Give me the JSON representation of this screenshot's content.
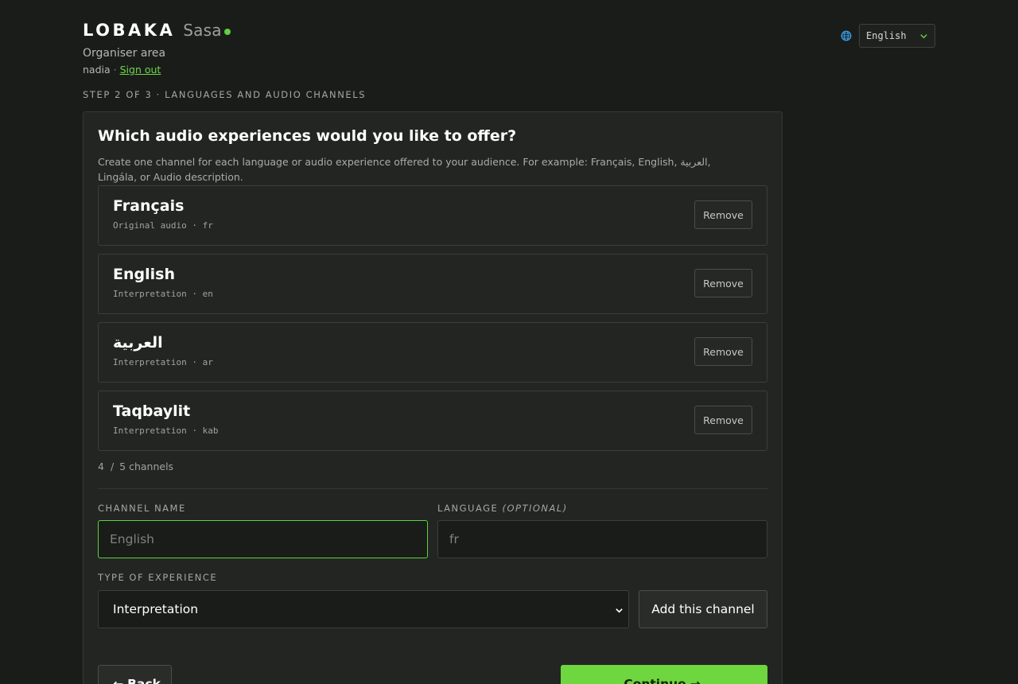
{
  "brand": {
    "name": "LOBAKA",
    "sub": "Sasa",
    "accent": "#5fd03f"
  },
  "header": {
    "area": "Organiser area",
    "user": "nadia",
    "separator": "·",
    "signout": "Sign out"
  },
  "lang_switch": {
    "icon": "globe-icon",
    "selected": "English",
    "chevron": "chevron-down-icon"
  },
  "step": "STEP 2 OF 3 · LANGUAGES AND AUDIO CHANNELS",
  "card": {
    "title": "Which audio experiences would you like to offer?",
    "description": "Create one channel for each language or audio experience offered to your audience. For example: Français, English, العربية, Lingála, or Audio description."
  },
  "channels": [
    {
      "name": "Français",
      "meta": "Original audio · fr",
      "remove": "Remove"
    },
    {
      "name": "English",
      "meta": "Interpretation · en",
      "remove": "Remove"
    },
    {
      "name": "العربية",
      "meta": "Interpretation · ar",
      "remove": "Remove"
    },
    {
      "name": "Taqbaylit",
      "meta": "Interpretation · kab",
      "remove": "Remove"
    }
  ],
  "count": {
    "current": "4",
    "separator": "/",
    "max": "5 channels"
  },
  "form": {
    "channel_name_label": "CHANNEL NAME",
    "channel_name_placeholder": "English",
    "language_label": "LANGUAGE",
    "language_optional": "(OPTIONAL)",
    "language_placeholder": "fr",
    "type_label": "TYPE OF EXPERIENCE",
    "type_value": "Interpretation",
    "add_button": "Add this channel"
  },
  "nav": {
    "back_arrow": "←",
    "back": "Back",
    "continue": "Continue",
    "continue_arrow": "→"
  }
}
